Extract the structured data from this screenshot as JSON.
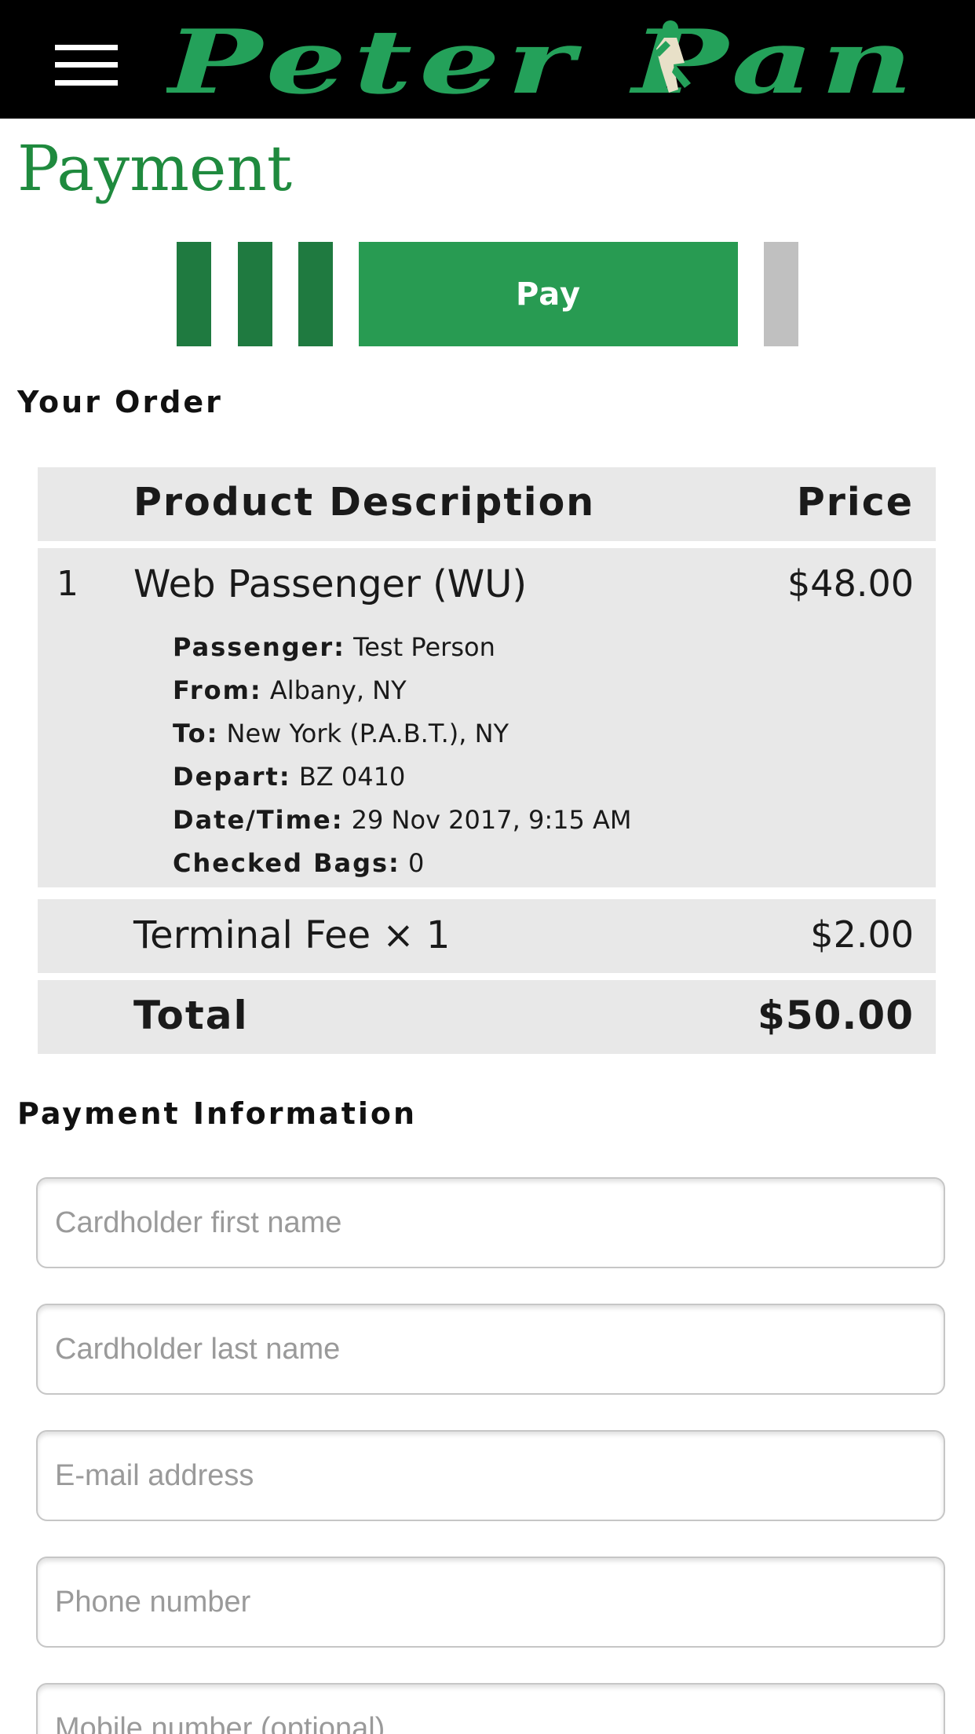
{
  "header": {
    "brand": "Peter Pan"
  },
  "page": {
    "title": "Payment"
  },
  "stepper": {
    "active_label": "Pay",
    "completed_steps": 3,
    "remaining_steps": 1
  },
  "order": {
    "heading": "Your Order",
    "columns": {
      "description": "Product Description",
      "price": "Price"
    },
    "items": [
      {
        "number": "1",
        "description": "Web Passenger (WU)",
        "price": "$48.00",
        "details": [
          {
            "label": "Passenger:",
            "value": "Test Person"
          },
          {
            "label": "From:",
            "value": "Albany, NY"
          },
          {
            "label": "To:",
            "value": "New York (P.A.B.T.), NY"
          },
          {
            "label": "Depart:",
            "value": "BZ 0410"
          },
          {
            "label": "Date/Time:",
            "value": "29 Nov 2017, 9:15 AM"
          },
          {
            "label": "Checked Bags:",
            "value": "0"
          }
        ]
      }
    ],
    "fee": {
      "description": "Terminal Fee × 1",
      "price": "$2.00"
    },
    "total": {
      "label": "Total",
      "price": "$50.00"
    }
  },
  "payment": {
    "heading": "Payment Information",
    "fields": {
      "first_name": {
        "placeholder": "Cardholder first name",
        "value": ""
      },
      "last_name": {
        "placeholder": "Cardholder last name",
        "value": ""
      },
      "email": {
        "placeholder": "E-mail address",
        "value": ""
      },
      "phone": {
        "placeholder": "Phone number",
        "value": ""
      },
      "mobile": {
        "placeholder": "Mobile number (optional)",
        "value": ""
      }
    }
  },
  "colors": {
    "brand_green": "#24a15a",
    "title_green": "#1f8a3e",
    "step_done": "#1f7a40",
    "step_active": "#289b52",
    "step_future": "#c0c0c0"
  }
}
